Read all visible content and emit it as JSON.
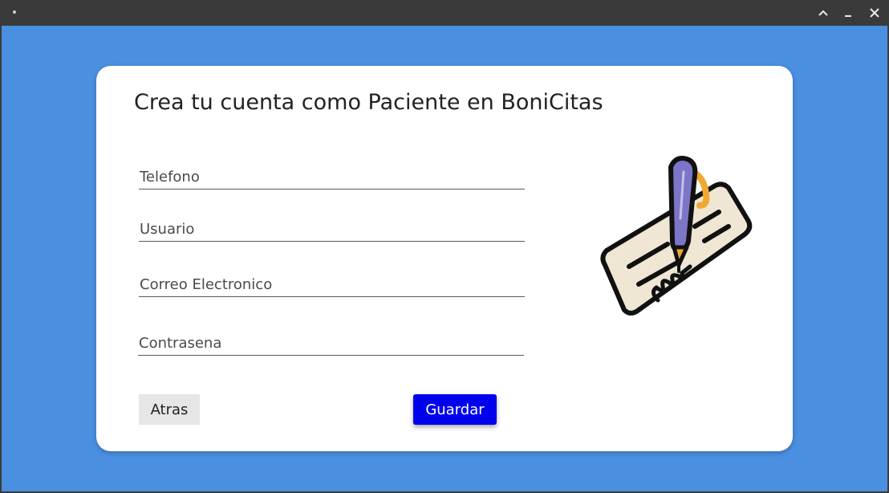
{
  "window": {
    "controls": {
      "maximize_icon": "chevron-up-icon",
      "minimize_icon": "minimize-icon",
      "close_icon": "close-icon"
    }
  },
  "form": {
    "title": "Crea tu cuenta como Paciente en BoniCitas",
    "fields": {
      "telefono": {
        "placeholder": "Telefono",
        "value": ""
      },
      "usuario": {
        "placeholder": "Usuario",
        "value": ""
      },
      "correo": {
        "placeholder": "Correo Electronico",
        "value": ""
      },
      "contrasena": {
        "placeholder": "Contrasena",
        "value": ""
      }
    },
    "buttons": {
      "back_label": "Atras",
      "save_label": "Guardar"
    },
    "illustration": "signed-check-pen-icon"
  },
  "colors": {
    "background": "#4a8fe0",
    "card": "#ffffff",
    "titlebar": "#3a3a3a",
    "save_button": "#0000ee",
    "back_button": "#e6e6e6"
  }
}
